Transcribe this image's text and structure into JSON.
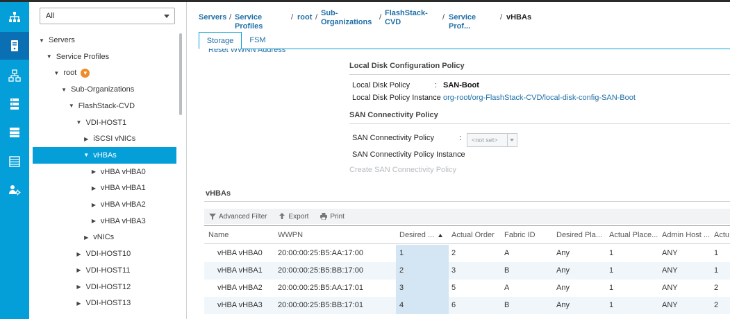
{
  "filter": {
    "value": "All"
  },
  "tree": [
    {
      "label": "Servers",
      "indent": 0,
      "toggle": "▼"
    },
    {
      "label": "Service Profiles",
      "indent": 1,
      "toggle": "▼"
    },
    {
      "label": "root",
      "indent": 2,
      "toggle": "▼",
      "badge": true
    },
    {
      "label": "Sub-Organizations",
      "indent": 3,
      "toggle": "▼"
    },
    {
      "label": "FlashStack-CVD",
      "indent": 4,
      "toggle": "▼"
    },
    {
      "label": "VDI-HOST1",
      "indent": 5,
      "toggle": "▼"
    },
    {
      "label": "iSCSI vNICs",
      "indent": 6,
      "toggle": "▶"
    },
    {
      "label": "vHBAs",
      "indent": 6,
      "toggle": "▼",
      "selected": true
    },
    {
      "label": "vHBA vHBA0",
      "indent": 7,
      "toggle": "▶"
    },
    {
      "label": "vHBA vHBA1",
      "indent": 7,
      "toggle": "▶"
    },
    {
      "label": "vHBA vHBA2",
      "indent": 7,
      "toggle": "▶"
    },
    {
      "label": "vHBA vHBA3",
      "indent": 7,
      "toggle": "▶"
    },
    {
      "label": "vNICs",
      "indent": 6,
      "toggle": "▶"
    },
    {
      "label": "VDI-HOST10",
      "indent": 5,
      "toggle": "▶"
    },
    {
      "label": "VDI-HOST11",
      "indent": 5,
      "toggle": "▶"
    },
    {
      "label": "VDI-HOST12",
      "indent": 5,
      "toggle": "▶"
    },
    {
      "label": "VDI-HOST13",
      "indent": 5,
      "toggle": "▶"
    }
  ],
  "breadcrumb": {
    "servers": "Servers",
    "service_profiles": "Service Profiles",
    "root": "root",
    "suborg_1": "Sub-",
    "suborg_2": "Organizations",
    "flash_1": "FlashStack-",
    "flash_2": "CVD",
    "service_prof": "Service Prof...",
    "current": "vHBAs",
    "separator": "/"
  },
  "tabs": {
    "storage": "Storage",
    "fsm": "FSM"
  },
  "reset_link": "Reset WWNN Address",
  "local_disk": {
    "title": "Local Disk Configuration Policy",
    "policy_label": "Local Disk Policy",
    "policy_colon": ":",
    "policy_value": "SAN-Boot",
    "instance_label": "Local Disk Policy Instance",
    "instance_colon": ":",
    "instance_value": "org-root/org-FlashStack-CVD/local-disk-config-SAN-Boot"
  },
  "san": {
    "title": "SAN Connectivity Policy",
    "policy_label": "SAN Connectivity Policy",
    "policy_colon": ":",
    "policy_value": "<not set>",
    "instance_label": "SAN Connectivity Policy Instance",
    "instance_colon": ":",
    "create_link": "Create SAN Connectivity Policy"
  },
  "vhbas_title": "vHBAs",
  "toolbar": {
    "advanced_filter": "Advanced Filter",
    "export": "Export",
    "print": "Print"
  },
  "columns": [
    "Name",
    "WWPN",
    "Desired ...",
    "Actual Order",
    "Fabric ID",
    "Desired Pla...",
    "Actual Place...",
    "Admin Host ...",
    "Actu"
  ],
  "rows": [
    [
      "vHBA vHBA0",
      "20:00:00:25:B5:AA:17:00",
      "1",
      "2",
      "A",
      "Any",
      "1",
      "ANY",
      "1"
    ],
    [
      "vHBA vHBA1",
      "20:00:00:25:B5:BB:17:00",
      "2",
      "3",
      "B",
      "Any",
      "1",
      "ANY",
      "1"
    ],
    [
      "vHBA vHBA2",
      "20:00:00:25:B5:AA:17:01",
      "3",
      "5",
      "A",
      "Any",
      "1",
      "ANY",
      "2"
    ],
    [
      "vHBA vHBA3",
      "20:00:00:25:B5:BB:17:01",
      "4",
      "6",
      "B",
      "Any",
      "1",
      "ANY",
      "2"
    ]
  ],
  "colors": {
    "accent": "#049fd9",
    "link": "#1f6fa7",
    "selected_nav": "#049fd9",
    "sorted_col": "#d4e6f3"
  },
  "icons": [
    "equipment-icon",
    "servers-icon",
    "lan-icon",
    "san-icon",
    "vm-icon",
    "storage-icon",
    "admin-icon"
  ]
}
